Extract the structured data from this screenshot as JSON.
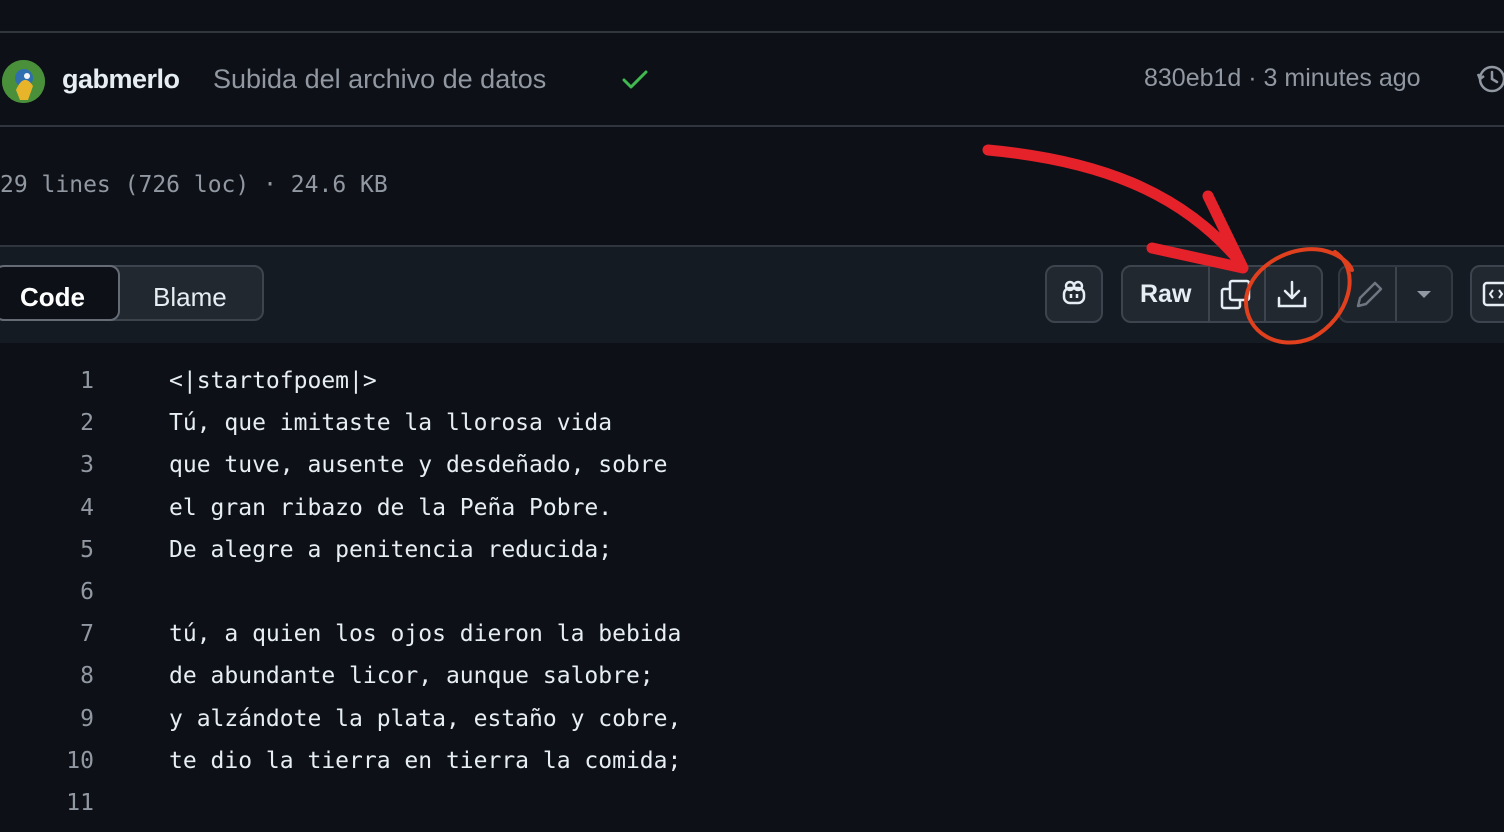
{
  "commit": {
    "author": "gabmerlo",
    "message": "Subida del archivo de datos",
    "meta": "830eb1d · 3 minutes ago"
  },
  "file": {
    "stats": "29 lines (726 loc) · 24.6 KB"
  },
  "toolbar": {
    "tab_code": "Code",
    "tab_blame": "Blame",
    "raw_label": "Raw"
  },
  "code": {
    "lines": [
      {
        "n": "1",
        "text": "<|startofpoem|>"
      },
      {
        "n": "2",
        "text": "Tú, que imitaste la llorosa vida"
      },
      {
        "n": "3",
        "text": "que tuve, ausente y desdeñado, sobre"
      },
      {
        "n": "4",
        "text": "el gran ribazo de la Peña Pobre."
      },
      {
        "n": "5",
        "text": "De alegre a penitencia reducida;"
      },
      {
        "n": "6",
        "text": ""
      },
      {
        "n": "7",
        "text": "tú, a quien los ojos dieron la bebida"
      },
      {
        "n": "8",
        "text": "de abundante licor, aunque salobre;"
      },
      {
        "n": "9",
        "text": "y alzándote la plata, estaño y cobre,"
      },
      {
        "n": "10",
        "text": "te dio la tierra en tierra la comida;"
      },
      {
        "n": "11",
        "text": ""
      }
    ]
  },
  "colors": {
    "background": "#0d1117",
    "border": "#30363d",
    "text": "#e6edf3",
    "muted": "#9198a1",
    "success": "#3fb950",
    "annotation_arrow": "#e5222a",
    "annotation_circle": "#e0401d"
  },
  "icons": [
    "avatar",
    "check-icon",
    "history-icon",
    "copilot-icon",
    "copy-icon",
    "download-icon",
    "pencil-icon",
    "chevron-down-icon",
    "code-view-icon"
  ]
}
